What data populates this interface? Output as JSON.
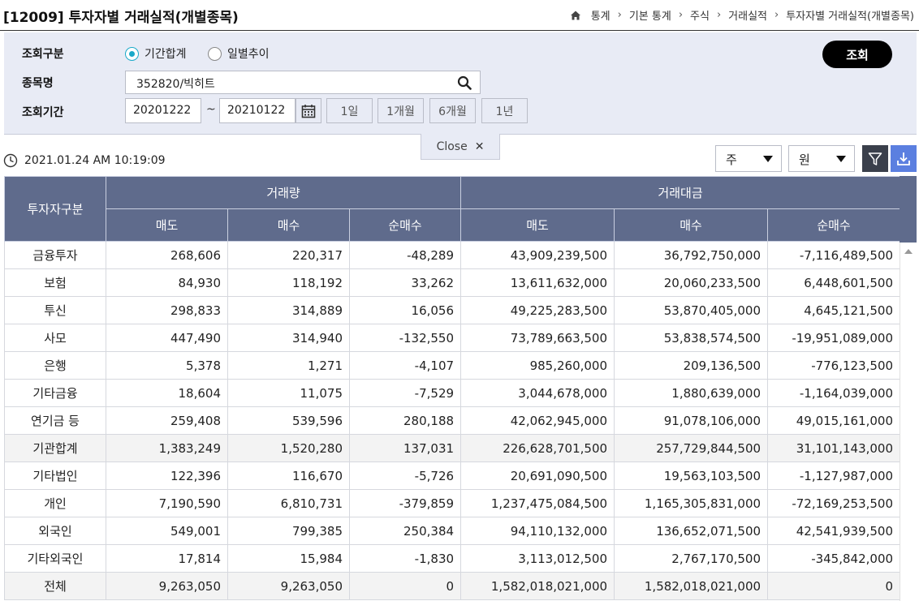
{
  "header": {
    "title": "[12009] 투자자별 거래실적(개별종목)",
    "breadcrumb": [
      "통계",
      "기본 통계",
      "주식",
      "거래실적",
      "투자자별 거래실적(개별종목)"
    ]
  },
  "search": {
    "type_label": "조회구분",
    "radio_period_sum": "기간합계",
    "radio_daily_trend": "일별추이",
    "selected": "기간합계",
    "stock_label": "종목명",
    "stock_value": "352820/빅히트",
    "period_label": "조회기간",
    "start_date": "20201222",
    "tilde": "~",
    "end_date": "20210122",
    "period_buttons": [
      "1일",
      "1개월",
      "6개월",
      "1년"
    ],
    "query_button": "조회",
    "close_label": "Close"
  },
  "toolbar": {
    "timestamp": "2021.01.24 AM 10:19:09",
    "period_unit": "주",
    "currency_unit": "원"
  },
  "table": {
    "col_investor": "투자자구분",
    "group_volume": "거래량",
    "group_value": "거래대금",
    "sub_sell": "매도",
    "sub_buy": "매수",
    "sub_net": "순매수",
    "rows": [
      {
        "name": "금융투자",
        "v_sell": "268,606",
        "v_buy": "220,317",
        "v_net": "-48,289",
        "a_sell": "43,909,239,500",
        "a_buy": "36,792,750,000",
        "a_net": "-7,116,489,500"
      },
      {
        "name": "보험",
        "v_sell": "84,930",
        "v_buy": "118,192",
        "v_net": "33,262",
        "a_sell": "13,611,632,000",
        "a_buy": "20,060,233,500",
        "a_net": "6,448,601,500"
      },
      {
        "name": "투신",
        "v_sell": "298,833",
        "v_buy": "314,889",
        "v_net": "16,056",
        "a_sell": "49,225,283,500",
        "a_buy": "53,870,405,000",
        "a_net": "4,645,121,500"
      },
      {
        "name": "사모",
        "v_sell": "447,490",
        "v_buy": "314,940",
        "v_net": "-132,550",
        "a_sell": "73,789,663,500",
        "a_buy": "53,838,574,500",
        "a_net": "-19,951,089,000"
      },
      {
        "name": "은행",
        "v_sell": "5,378",
        "v_buy": "1,271",
        "v_net": "-4,107",
        "a_sell": "985,260,000",
        "a_buy": "209,136,500",
        "a_net": "-776,123,500"
      },
      {
        "name": "기타금융",
        "v_sell": "18,604",
        "v_buy": "11,075",
        "v_net": "-7,529",
        "a_sell": "3,044,678,000",
        "a_buy": "1,880,639,000",
        "a_net": "-1,164,039,000"
      },
      {
        "name": "연기금 등",
        "v_sell": "259,408",
        "v_buy": "539,596",
        "v_net": "280,188",
        "a_sell": "42,062,945,000",
        "a_buy": "91,078,106,000",
        "a_net": "49,015,161,000"
      },
      {
        "name": "기관합계",
        "v_sell": "1,383,249",
        "v_buy": "1,520,280",
        "v_net": "137,031",
        "a_sell": "226,628,701,500",
        "a_buy": "257,729,844,500",
        "a_net": "31,101,143,000"
      },
      {
        "name": "기타법인",
        "v_sell": "122,396",
        "v_buy": "116,670",
        "v_net": "-5,726",
        "a_sell": "20,691,090,500",
        "a_buy": "19,563,103,500",
        "a_net": "-1,127,987,000"
      },
      {
        "name": "개인",
        "v_sell": "7,190,590",
        "v_buy": "6,810,731",
        "v_net": "-379,859",
        "a_sell": "1,237,475,084,500",
        "a_buy": "1,165,305,831,000",
        "a_net": "-72,169,253,500"
      },
      {
        "name": "외국인",
        "v_sell": "549,001",
        "v_buy": "799,385",
        "v_net": "250,384",
        "a_sell": "94,110,132,000",
        "a_buy": "136,652,071,500",
        "a_net": "42,541,939,500"
      },
      {
        "name": "기타외국인",
        "v_sell": "17,814",
        "v_buy": "15,984",
        "v_net": "-1,830",
        "a_sell": "3,113,012,500",
        "a_buy": "2,767,170,500",
        "a_net": "-345,842,000"
      },
      {
        "name": "전체",
        "v_sell": "9,263,050",
        "v_buy": "9,263,050",
        "v_net": "0",
        "a_sell": "1,582,018,021,000",
        "a_buy": "1,582,018,021,000",
        "a_net": "0"
      }
    ]
  },
  "colors": {
    "header_bg": "#5f6b8c",
    "panel_bg": "#e8ebf5",
    "accent": "#1aa9c9",
    "download_btn": "#5b7fe0"
  },
  "icons": [
    "home-icon",
    "search-icon",
    "calendar-icon",
    "close-icon",
    "clock-icon",
    "filter-icon",
    "download-icon"
  ]
}
